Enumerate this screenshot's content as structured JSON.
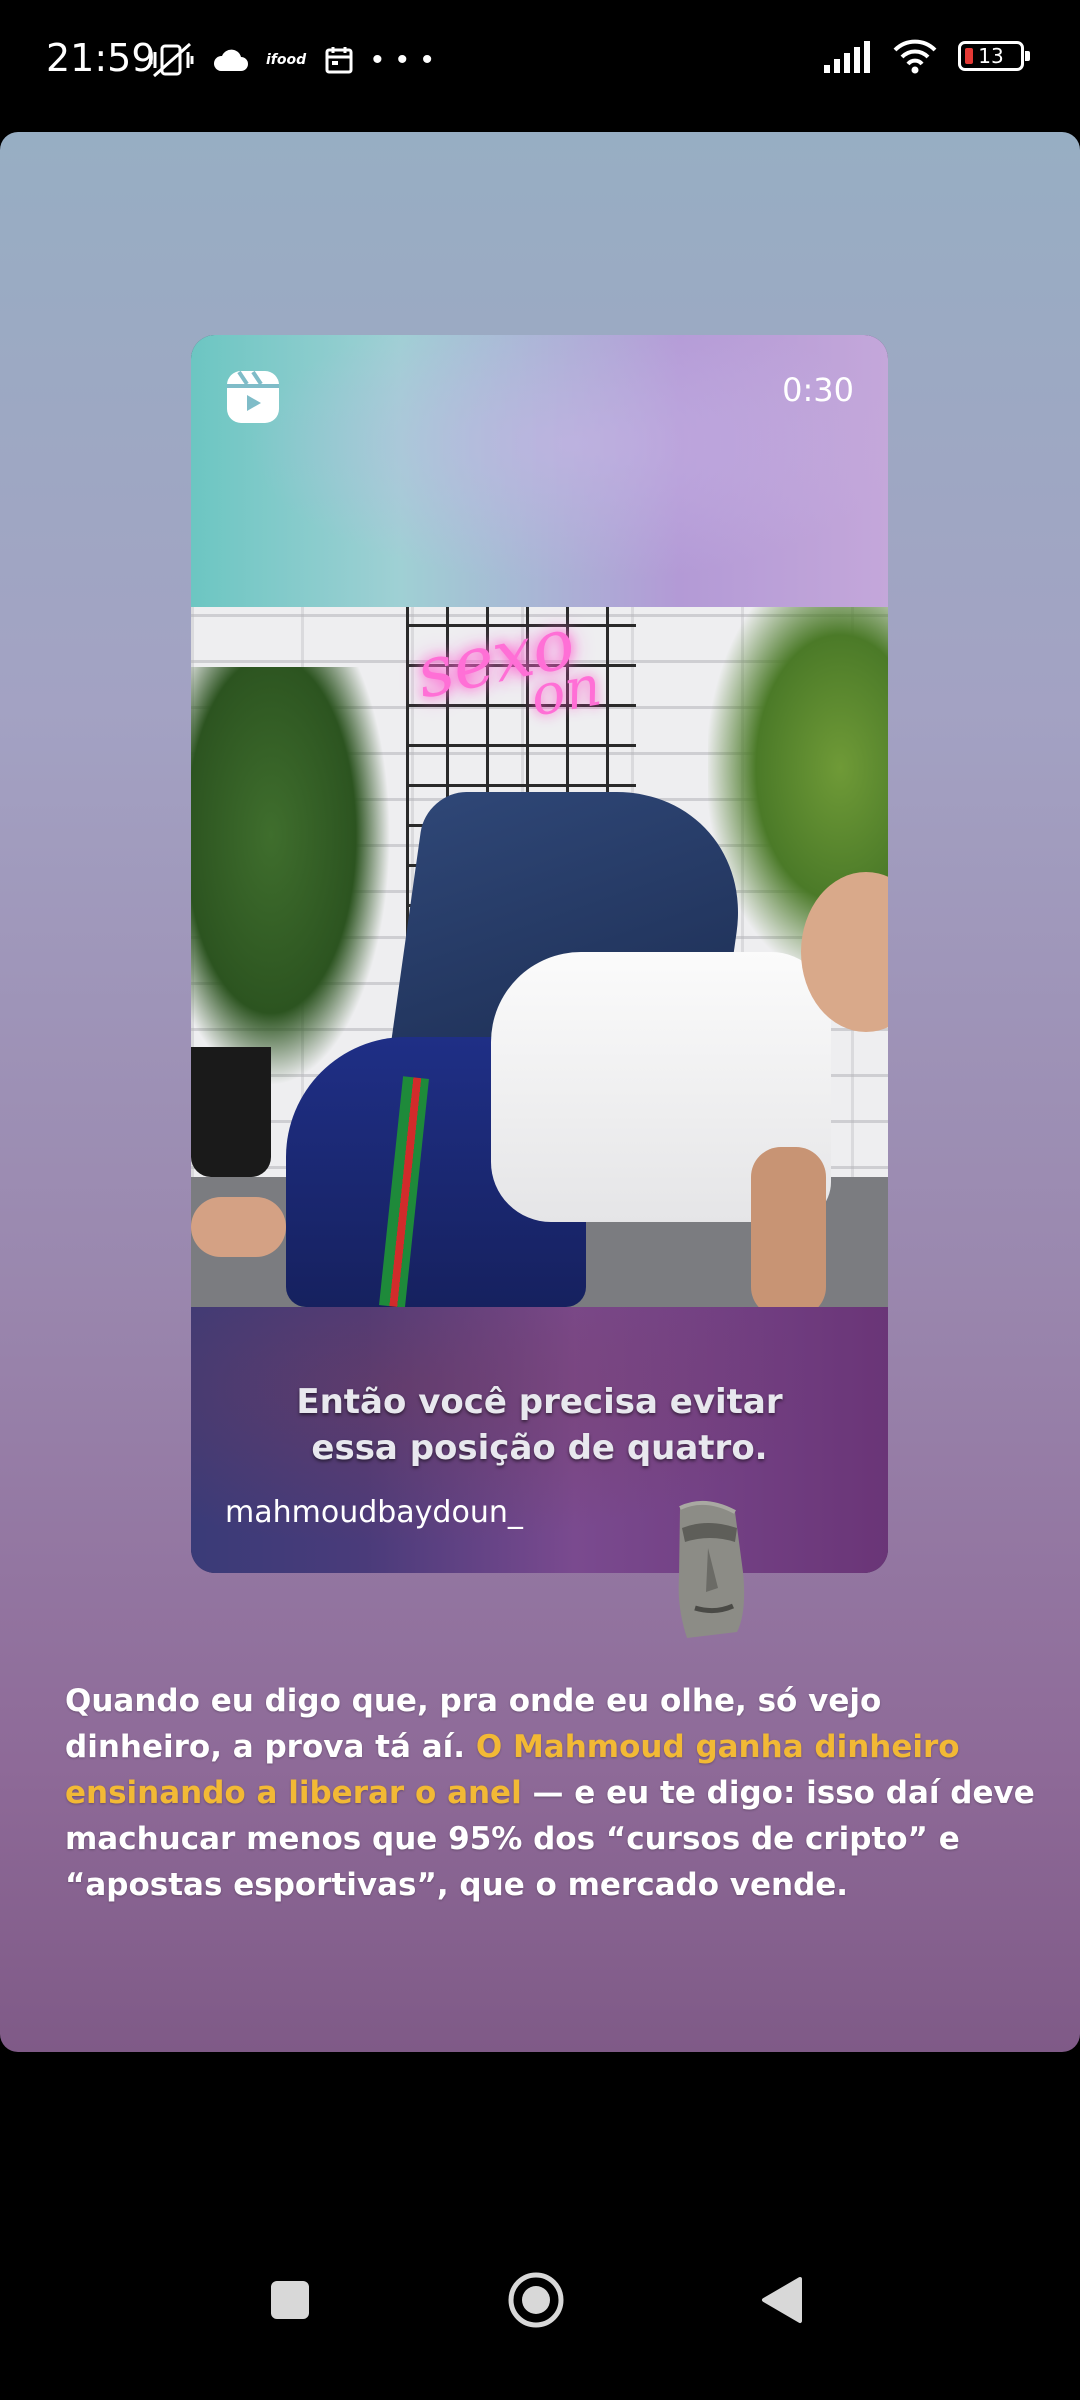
{
  "status_bar": {
    "time": "21:59",
    "ifood_label": "ifood",
    "more_dots": "• • •",
    "battery_level": "13"
  },
  "reel": {
    "duration": "0:30",
    "neon_sign": "sexo",
    "neon_sign_2": "on",
    "caption_line1": "Então você precisa evitar",
    "caption_line2": "essa posição de quatro.",
    "username": "mahmoudbaydoun_"
  },
  "story_text": {
    "line1": "Quando eu digo que, pra onde eu olhe, só vejo",
    "line2_a": "dinheiro, a prova tá aí. ",
    "line2_b_highlight": "O Mahmoud ganha dinheiro",
    "line3_a_highlight": "ensinando a liberar o anel",
    "line3_b": " — e eu te digo: isso daí deve",
    "line4": "machucar menos que 95% dos “cursos de cripto” e",
    "line5": "“apostas esportivas”, que o mercado vende."
  },
  "colors": {
    "highlight": "#f2b935",
    "battery_low": "#e53935"
  }
}
